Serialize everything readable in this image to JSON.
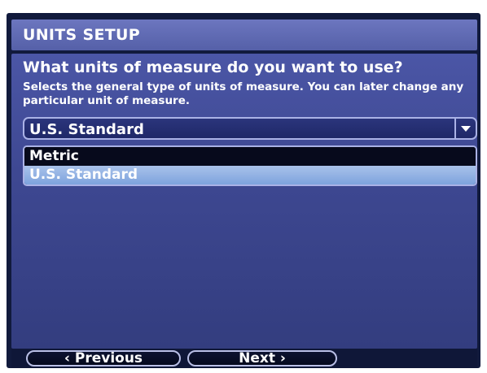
{
  "title": "UNITS SETUP",
  "question": "What units of measure do you want to use?",
  "description": "Selects the general type of units of measure. You can later change any particular unit of measure.",
  "dropdown": {
    "selected": "U.S. Standard",
    "options": [
      "Metric",
      "U.S. Standard"
    ],
    "highlighted": "U.S. Standard"
  },
  "buttons": {
    "previous": "‹ Previous",
    "next": "Next ›"
  },
  "colors": {
    "title_bar": "#5c66b0",
    "panel": "#3e4892",
    "highlight": "#8fb0e3"
  },
  "icons": {
    "dropdown_arrow": "chevron-down-icon"
  }
}
